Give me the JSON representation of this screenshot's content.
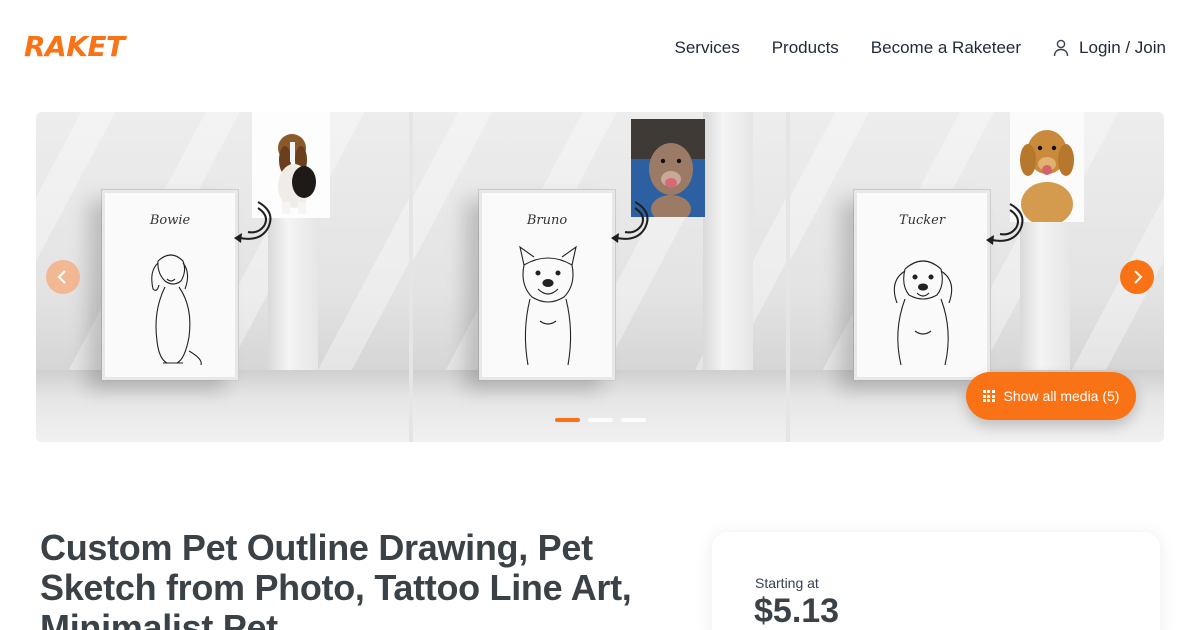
{
  "header": {
    "logo_text": "RAKET",
    "nav": {
      "services": "Services",
      "products": "Products",
      "become": "Become a Raketeer",
      "login": "Login / Join"
    }
  },
  "carousel": {
    "slides": [
      {
        "pet_name": "Bowie"
      },
      {
        "pet_name": "Bruno"
      },
      {
        "pet_name": "Tucker"
      }
    ],
    "show_all_label": "Show all media (5)",
    "dots_total": 3,
    "active_dot": 1
  },
  "listing": {
    "title": "Custom Pet Outline Drawing, Pet Sketch from Photo, Tattoo Line Art, Minimalist Pet"
  },
  "pricing": {
    "starting_label": "Starting at",
    "price": "$5.13"
  },
  "colors": {
    "accent": "#f97316",
    "text_dark": "#3a4147"
  },
  "icons": {
    "user": "user-icon",
    "prev": "chevron-left-icon",
    "next": "chevron-right-icon",
    "grid": "grid-icon"
  }
}
